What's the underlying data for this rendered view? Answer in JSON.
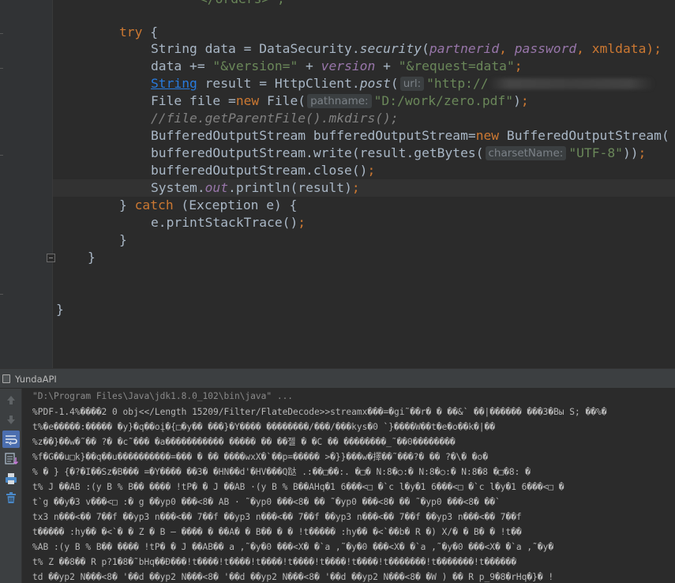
{
  "editor": {
    "lines": {
      "l0": "</orders>\";",
      "try_kw": "try",
      "try_brace": " {",
      "l2a": "String data = DataSecurity.",
      "l2b": "security",
      "l2c": "(",
      "l2d": "partnerid",
      "l2e": ", ",
      "l2f": "password",
      "l2g": ", xmldata)",
      "l2h": ";",
      "l3a": "data += ",
      "l3b": "\"&version=\"",
      "l3c": " + ",
      "l3d": "version",
      "l3e": " + ",
      "l3f": "\"&request=data\"",
      "l3g": ";",
      "l4a": "String",
      "l4b": " result = HttpClient.",
      "l4c": "post",
      "l4d": "(",
      "l4hint": "url:",
      "l4e": "\"http://",
      "l5a": "File file =",
      "l5b": "new",
      "l5c": " File(",
      "l5hint": "pathname:",
      "l5d": "\"D:/work/zero.pdf\"",
      "l5e": ")",
      "l5f": ";",
      "l6": "//file.getParentFile().mkdirs();",
      "l7a": "BufferedOutputStream bufferedOutputStream=",
      "l7b": "new",
      "l7c": " BufferedOutputStream(",
      "l8a": "bufferedOutputStream.write(result.getBytes(",
      "l8hint": "charsetName:",
      "l8b": "\"UTF-8\"",
      "l8c": "))",
      "l8d": ";",
      "l9a": "bufferedOutputStream.close()",
      "l9b": ";",
      "l10a": "System.",
      "l10b": "out",
      "l10c": ".println(result)",
      "l10d": ";",
      "l11a": "} ",
      "l11b": "catch",
      "l11c": " (Exception e) {",
      "l12a": "e.printStackTrace()",
      "l12b": ";",
      "l13": "}",
      "l14": "}",
      "l15": "}"
    }
  },
  "run_panel": {
    "title": "YundaAPI",
    "toolbar": [
      {
        "icon": "arrow-up-icon"
      },
      {
        "icon": "arrow-down-icon"
      },
      {
        "icon": "soft-wrap-icon"
      },
      {
        "icon": "scroll-to-end-icon"
      },
      {
        "icon": "print-icon"
      },
      {
        "icon": "trash-icon"
      }
    ],
    "console": [
      "\"D:\\Program Files\\Java\\jdk1.8.0_102\\bin\\java\" ...",
      "%PDF-1.4%����2 0 obj<</Length 15209/Filter/FlateDecode>>streamx���=�gi˜��r� � ��&` ��|������ ���3�Bы S; ��%�",
      "t%�e�����:����� �y}�q��oį�{□�y�� ���}�Y���� ��������/���/���kys�0 `}����W��t�e�o��k�|��",
      "%z��}��w�˜�� ?� �c˜��� �a����������� ����� �� ��젤 � �C �� ��������_˜��0��������",
      "%f�G��u□k}��q��u����������=��� � �� ����wxX�`��p=����� >�}}���w�擇��˜���?� �� ?�\\� �o�",
      "% � } {�?�I��Sz�B��� =�Y���� ��3� �HN��d'�HV���Q跶 .:��□��:. �□� N:8�○:� N:8�○:� N:8�8 �□�8: �",
      "t% J ��AB :(y B % B�� ���� !tP� � J ��AB ·(y B % B��AHq�1 6���<□ �`c l�y�1 6���<□ �`c l�y�1 6���<□ �",
      "t`g ��y�3 v���<□ :� g ��yp0 ���<8� AB · ˜�yp0 ���<8� �� ˜�yp0 ���<8� �� ˜�yp0 ���<8� ��`",
      "tx3 n���<�� 7��f ��yp3 n���<�� 7��f ��yp3 n���<�� 7��f ��yp3 n���<�� 7��f ��yp3 n���<�� 7��f",
      "t����� :hy�� �<`� � Z � B – ���� � ��A� � B�� � � !t����� :hy�� �<`��b� R �) X/� � B� � !t��",
      "%AB :(y B % B�� ���� !tP� � J ��AB�� a ,˜�y�0 ���<X� �`a ,˜�y�0 ���<X� �`a ,˜�y�0 ���<X� �`a ,˜�y�",
      "t% Z ��8�� R p?1�8�˜bHq��Ð���!t����!t����!t����!t����!t����!t����!t�������!t�������!t������",
      "td ��yp2 N���<8� '��d ��yp2 N���<8� '��d ��yp2 N���<8� '��d ��yp2 N���<8� �W ) �� R p_9�8�rHq�}� !"
    ]
  }
}
